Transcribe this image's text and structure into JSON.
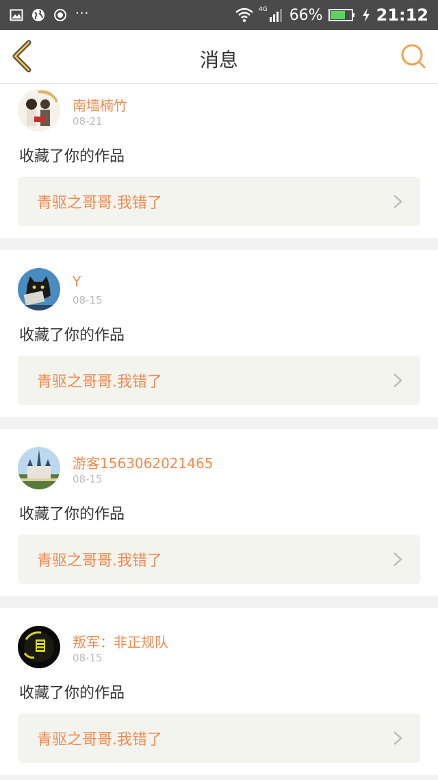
{
  "status_bar": {
    "network": "4G",
    "battery_percent": "66%",
    "time": "21:12",
    "icons": [
      "image-icon",
      "globe-icon",
      "record-icon",
      "more-dots-icon",
      "wifi-icon",
      "signal-icon",
      "battery-icon",
      "charging-icon"
    ]
  },
  "header": {
    "title": "消息",
    "accent_color": "#f0a050"
  },
  "messages": [
    {
      "user": "南墙楠竹",
      "date": "08-21",
      "action": "收藏了你的作品",
      "work_title": "青驱之哥哥.我错了",
      "avatar": "couple-illustration"
    },
    {
      "user": "Y",
      "date": "08-15",
      "action": "收藏了你的作品",
      "work_title": "青驱之哥哥.我错了",
      "avatar": "black-cat"
    },
    {
      "user": "游客1563062021465",
      "date": "08-15",
      "action": "收藏了你的作品",
      "work_title": "青驱之哥哥.我错了",
      "avatar": "castle"
    },
    {
      "user": "叛军：非正规队",
      "date": "08-15",
      "action": "收藏了你的作品",
      "work_title": "青驱之哥哥.我错了",
      "avatar": "dark-face"
    }
  ]
}
